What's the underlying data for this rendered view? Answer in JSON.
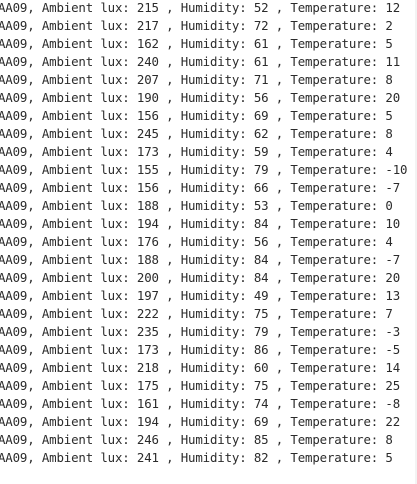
{
  "console": {
    "lines": [
      "AA09, Ambient lux: 215 , Humidity: 52 , Temperature: 12",
      "AA09, Ambient lux: 217 , Humidity: 72 , Temperature: 2",
      "AA09, Ambient lux: 162 , Humidity: 61 , Temperature: 5",
      "AA09, Ambient lux: 240 , Humidity: 61 , Temperature: 11",
      "AA09, Ambient lux: 207 , Humidity: 71 , Temperature: 8",
      "AA09, Ambient lux: 190 , Humidity: 56 , Temperature: 20",
      "AA09, Ambient lux: 156 , Humidity: 69 , Temperature: 5",
      "AA09, Ambient lux: 245 , Humidity: 62 , Temperature: 8",
      "AA09, Ambient lux: 173 , Humidity: 59 , Temperature: 4",
      "AA09, Ambient lux: 155 , Humidity: 79 , Temperature: -10",
      "AA09, Ambient lux: 156 , Humidity: 66 , Temperature: -7",
      "AA09, Ambient lux: 188 , Humidity: 53 , Temperature: 0",
      "AA09, Ambient lux: 194 , Humidity: 84 , Temperature: 10",
      "AA09, Ambient lux: 176 , Humidity: 56 , Temperature: 4",
      "AA09, Ambient lux: 188 , Humidity: 84 , Temperature: -7",
      "AA09, Ambient lux: 200 , Humidity: 84 , Temperature: 20",
      "AA09, Ambient lux: 197 , Humidity: 49 , Temperature: 13",
      "AA09, Ambient lux: 222 , Humidity: 75 , Temperature: 7",
      "AA09, Ambient lux: 235 , Humidity: 79 , Temperature: -3",
      "AA09, Ambient lux: 173 , Humidity: 86 , Temperature: -5",
      "AA09, Ambient lux: 218 , Humidity: 60 , Temperature: 14",
      "AA09, Ambient lux: 175 , Humidity: 75 , Temperature: 25",
      "AA09, Ambient lux: 161 , Humidity: 74 , Temperature: -8",
      "AA09, Ambient lux: 194 , Humidity: 69 , Temperature: 22",
      "AA09, Ambient lux: 246 , Humidity: 85 , Temperature: 8",
      "AA09, Ambient lux: 241 , Humidity: 82 , Temperature: 5"
    ]
  }
}
